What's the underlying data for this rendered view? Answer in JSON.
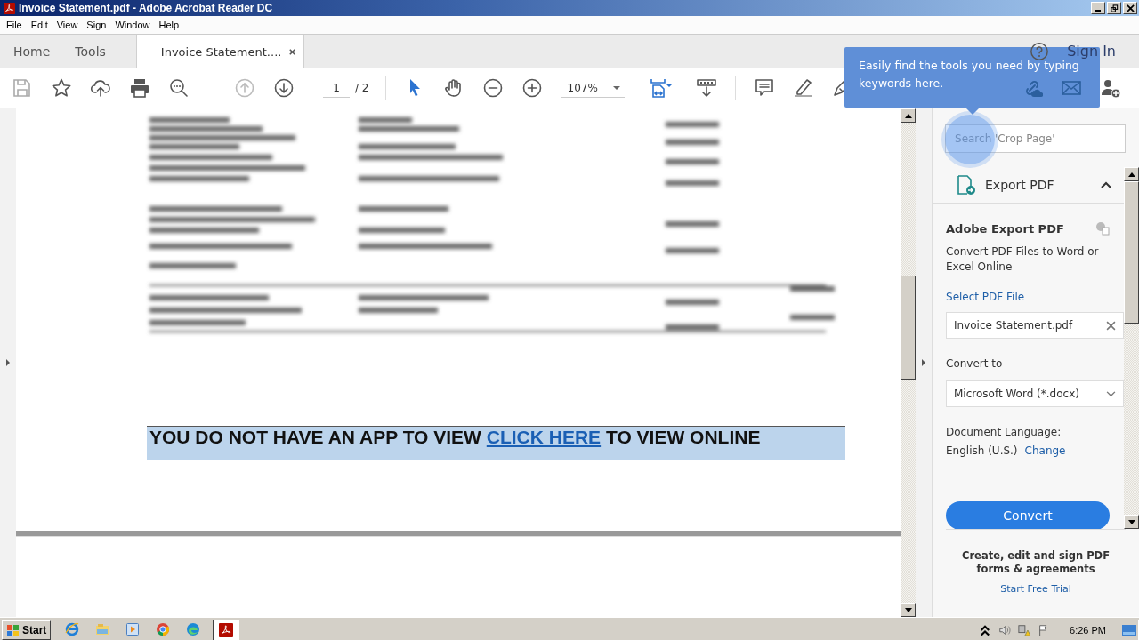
{
  "window": {
    "title": "Invoice Statement.pdf - Adobe Acrobat Reader DC"
  },
  "menu": [
    "File",
    "Edit",
    "View",
    "Sign",
    "Window",
    "Help"
  ],
  "nav_tabs": [
    {
      "label": "Home",
      "selected": false
    },
    {
      "label": "Tools",
      "selected": false
    },
    {
      "label": "Invoice Statement....",
      "selected": true
    }
  ],
  "header": {
    "sign_in": "Sign In"
  },
  "toolbar": {
    "page": "1",
    "page_total": "/ 2",
    "zoom": "107%"
  },
  "tooltip": "Easily find the tools you need by typing keywords here.",
  "document": {
    "banner_before": "YOU DO NOT HAVE AN APP TO VIEW",
    "banner_link": "CLICK HERE",
    "banner_after": "TO VIEW ONLINE"
  },
  "tools_pane": {
    "search_placeholder": "Search 'Crop Page'",
    "tool_title": "Export PDF",
    "expanded": true,
    "card_title": "Adobe Export PDF",
    "description": "Convert PDF Files to Word or Excel Online",
    "select_label": "Select PDF File",
    "file": "Invoice Statement.pdf",
    "convert_label": "Convert to",
    "format": "Microsoft Word (*.docx)",
    "language_label": "Document Language:",
    "language": "English (U.S.)",
    "change": "Change",
    "button": "Convert",
    "promo": "Create, edit and sign PDF forms & agreements",
    "trial": "Start Free Trial"
  },
  "taskbar": {
    "start": "Start",
    "apps": [
      {
        "kind": "ie",
        "selected": false
      },
      {
        "kind": "explorer",
        "selected": false
      },
      {
        "kind": "media",
        "selected": false
      },
      {
        "kind": "chrome",
        "selected": false
      },
      {
        "kind": "edge",
        "selected": false
      },
      {
        "kind": "acrobat",
        "selected": true
      }
    ],
    "clock": "6:26 PM"
  }
}
